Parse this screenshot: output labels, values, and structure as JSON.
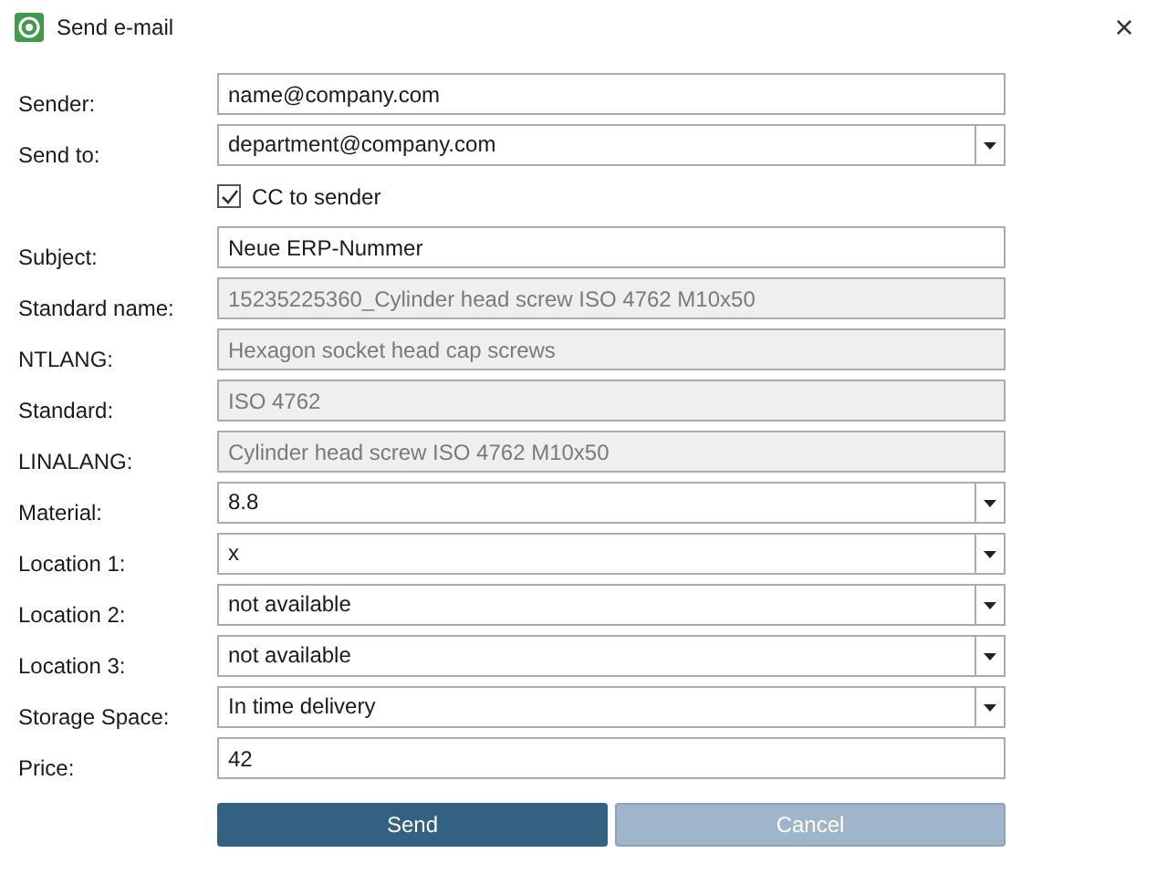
{
  "window": {
    "title": "Send e-mail",
    "close": "×"
  },
  "rows": [
    {
      "kind": "text",
      "label": "Sender:",
      "value": "name@company.com"
    },
    {
      "kind": "combo",
      "label": "Send to:",
      "value": "department@company.com"
    },
    {
      "kind": "checkbox",
      "label": "CC to sender",
      "checked": true
    },
    {
      "kind": "text",
      "label": "Subject:",
      "value": "Neue ERP-Nummer"
    },
    {
      "kind": "readonly",
      "label": "Standard name:",
      "value": "15235225360_Cylinder head screw ISO 4762 M10x50"
    },
    {
      "kind": "readonly",
      "label": "NTLANG:",
      "value": "Hexagon socket head cap screws"
    },
    {
      "kind": "readonly",
      "label": "Standard:",
      "value": "ISO 4762"
    },
    {
      "kind": "readonly",
      "label": "LINALANG:",
      "value": "Cylinder head screw ISO 4762 M10x50"
    },
    {
      "kind": "combo",
      "label": "Material:",
      "value": "8.8"
    },
    {
      "kind": "combo",
      "label": "Location 1:",
      "value": "x"
    },
    {
      "kind": "combo",
      "label": "Location 2:",
      "value": "not available"
    },
    {
      "kind": "combo",
      "label": "Location 3:",
      "value": "not available"
    },
    {
      "kind": "combo",
      "label": "Storage Space:",
      "value": "In time delivery"
    },
    {
      "kind": "text",
      "label": "Price:",
      "value": "42"
    }
  ],
  "buttons": [
    {
      "label": "Send",
      "disabled": false
    },
    {
      "label": "Cancel",
      "disabled": true
    }
  ]
}
